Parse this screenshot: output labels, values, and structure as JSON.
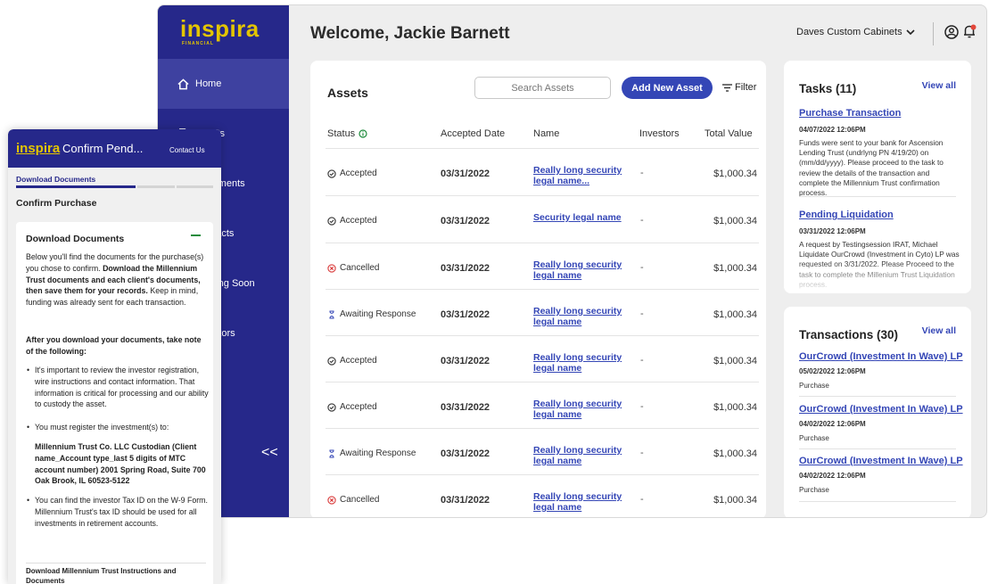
{
  "desktop": {
    "logo": "inspira",
    "logo_sub": "FINANCIAL",
    "nav": [
      {
        "label": "Home",
        "icon": "home-icon"
      },
      {
        "label": "Assets",
        "icon": "document-icon"
      },
      {
        "label": "Documents",
        "icon": "folder-icon"
      },
      {
        "label": "Contacts",
        "icon": "contacts-icon"
      },
      {
        "label": "Coming Soon",
        "icon": "clock-icon"
      },
      {
        "label": "Investors",
        "icon": "people-icon"
      }
    ],
    "collapse_label": "<<",
    "welcome": "Welcome, Jackie Barnett",
    "company": "Daves Custom Cabinets",
    "assets": {
      "title": "Assets",
      "search_placeholder": "Search Assets",
      "add_button": "Add New Asset",
      "filter": "Filter",
      "columns": [
        "Status",
        "Accepted Date",
        "Name",
        "Investors",
        "Total Value"
      ],
      "rows": [
        {
          "status": "Accepted",
          "date": "03/31/2022",
          "name": "Really long security legal name...",
          "investors": "-",
          "value": "$1,000.34"
        },
        {
          "status": "Accepted",
          "date": "03/31/2022",
          "name": "Security legal name",
          "investors": "-",
          "value": "$1,000.34"
        },
        {
          "status": "Cancelled",
          "date": "03/31/2022",
          "name": "Really long security legal name",
          "investors": "-",
          "value": "$1,000.34"
        },
        {
          "status": "Awaiting Response",
          "date": "03/31/2022",
          "name": "Really long security legal name",
          "investors": "-",
          "value": "$1,000.34"
        },
        {
          "status": "Accepted",
          "date": "03/31/2022",
          "name": "Really long security legal name",
          "investors": "-",
          "value": "$1,000.34"
        },
        {
          "status": "Accepted",
          "date": "03/31/2022",
          "name": "Really long security legal name",
          "investors": "-",
          "value": "$1,000.34"
        },
        {
          "status": "Awaiting Response",
          "date": "03/31/2022",
          "name": "Really long security legal name",
          "investors": "-",
          "value": "$1,000.34"
        },
        {
          "status": "Cancelled",
          "date": "03/31/2022",
          "name": "Really long security legal name",
          "investors": "-",
          "value": "$1,000.34"
        }
      ]
    },
    "tasks": {
      "title": "Tasks (11)",
      "view_all": "View all",
      "items": [
        {
          "title": "Purchase Transaction",
          "date": "04/07/2022 12:06PM",
          "desc": "Funds were sent to your bank for Ascension Lending Trust (undrlyng PN 4/19/20) on (mm/dd/yyyy). Please proceed to the task to review the details of the transaction and complete the Millennium Trust confirmation process."
        },
        {
          "title": "Pending Liquidation",
          "date": "03/31/2022 12:06PM",
          "desc": "A request by Testingsession IRAT, Michael Liquidate OurCrowd (Investment in Cyto) LP was requested on 3/31/2022. Please Proceed to the task to complete the Millenium Trust Liquidation process."
        }
      ]
    },
    "transactions": {
      "title": "Transactions (30)",
      "view_all": "View all",
      "items": [
        {
          "title": "OurCrowd (Investment In Wave) LP",
          "date": "05/02/2022 12:06PM",
          "type": "Purchase"
        },
        {
          "title": "OurCrowd (Investment In Wave) LP",
          "date": "04/02/2022 12:06PM",
          "type": "Purchase"
        },
        {
          "title": "OurCrowd (Investment In Wave) LP",
          "date": "04/02/2022 12:06PM",
          "type": "Purchase"
        }
      ]
    }
  },
  "mobile": {
    "logo": "inspira",
    "title": "Confirm Pend...",
    "contact": "Contact Us",
    "step_label": "Download Documents",
    "section_title": "Confirm Purchase",
    "card_title": "Download Documents",
    "intro_1": "Below you'll find the documents for the purchase(s) you chose to confirm.",
    "intro_2": "Download the Millennium Trust documents and each client's documents, then save them for your records.",
    "intro_3": "Keep in mind, funding was already sent for each transaction.",
    "after_heading": "After you download your documents, take note of the following:",
    "bullets": [
      "It's important to review the investor registration, wire instructions and contact information. That information is critical for processing and our ability to custody the asset.",
      "You must register the investment(s) to:",
      "You can find the investor Tax ID on the W-9 Form. Millennium Trust's tax ID should be used for all investments in retirement accounts."
    ],
    "register_to": "Millennium Trust Co. LLC Custodian (Client name_Account type_last 5 digits of MTC account number) 2001 Spring Road, Suite 700 Oak Brook, IL 60523-5122",
    "footer_link": "Download Millennium Trust Instructions and Documents"
  },
  "colors": {
    "sidebar": "#26288a",
    "accent": "#3446b6",
    "logo": "#e3c500",
    "notification": "#e2463a",
    "success": "#1e8b3c",
    "cancelled": "#d93b3b"
  }
}
